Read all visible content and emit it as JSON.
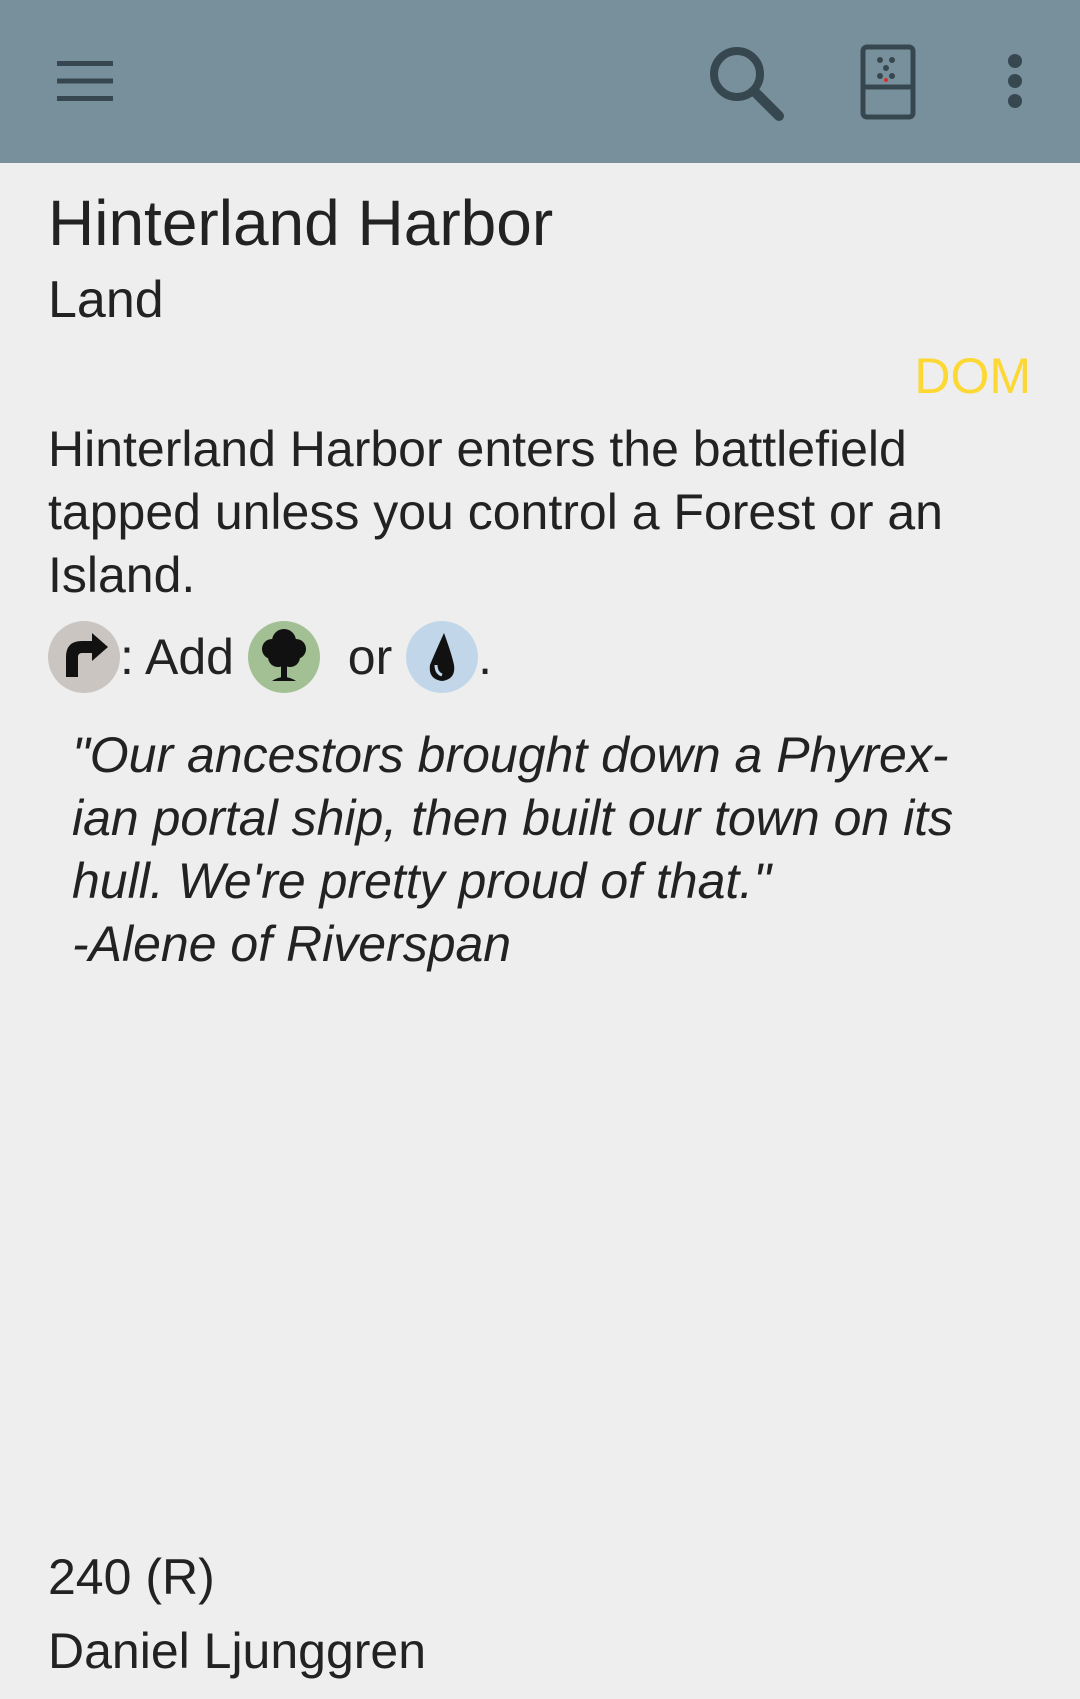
{
  "toolbar": {
    "icons": [
      "menu-icon",
      "search-icon",
      "dice-icon",
      "more-vert-icon"
    ],
    "background": "#78909c"
  },
  "card": {
    "name": "Hinterland Harbor",
    "type_line": "Land",
    "set_code": "DOM",
    "set_color": "#fdd835",
    "rules_text": "Hinterland Harbor enters the battlefield tapped unless you control a Forest or an Island.",
    "mana_ability": {
      "cost_symbol": "tap-symbol",
      "text_add": ": Add ",
      "symbol_green": "green-mana-symbol",
      "text_or": " or ",
      "symbol_blue": "blue-mana-symbol",
      "text_end": "."
    },
    "flavor_text": "\"Our ancestors brought down a Phyrex-\nian portal ship, then built our town on its\nhull. We're pretty proud of that.\"\n-Alene of Riverspan",
    "collector_number": "240 (R)",
    "artist": "Daniel Ljunggren"
  }
}
